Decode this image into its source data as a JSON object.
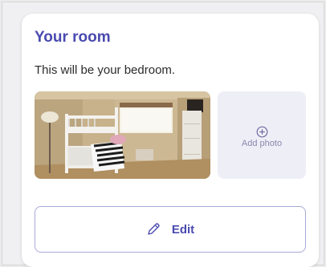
{
  "card": {
    "title": "Your room",
    "description": "This will be your bedroom.",
    "add_photo_label": "Add photo",
    "edit_label": "Edit"
  },
  "icons": {
    "add": "plus-circle-icon",
    "edit": "pencil-icon"
  },
  "colors": {
    "accent": "#4a4ab0",
    "tile_background": "#eeeef6",
    "button_border": "#a8a8d8"
  }
}
